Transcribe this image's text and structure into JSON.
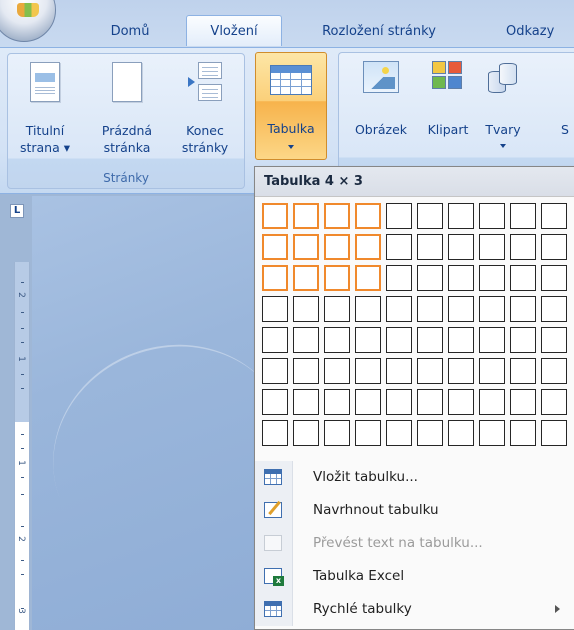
{
  "tabs": [
    {
      "label": "Domů",
      "active": false
    },
    {
      "label": "Vložení",
      "active": true
    },
    {
      "label": "Rozložení stránky",
      "active": false
    },
    {
      "label": "Odkazy",
      "active": false
    }
  ],
  "ribbon": {
    "group_pages": {
      "label": "Stránky",
      "buttons": [
        {
          "line1": "Titulní",
          "line2": "strana ▾",
          "icon": "cover-page-icon"
        },
        {
          "line1": "Prázdná",
          "line2": "stránka",
          "icon": "blank-page-icon"
        },
        {
          "line1": "Konec",
          "line2": "stránky",
          "icon": "page-break-icon"
        }
      ]
    },
    "table_button": {
      "label": "Tabulka",
      "icon": "table-icon"
    },
    "group_illustrations": {
      "buttons": [
        {
          "label": "Obrázek",
          "icon": "picture-icon"
        },
        {
          "label": "Klipart",
          "icon": "clipart-icon"
        },
        {
          "label": "Tvary",
          "icon": "shapes-icon"
        },
        {
          "label": "S",
          "icon": "smartart-icon"
        }
      ]
    }
  },
  "ruler": {
    "corner_label": "L",
    "marks": [
      "2",
      "1",
      "1",
      "2",
      "3"
    ]
  },
  "dropdown": {
    "title": "Tabulka 4 × 3",
    "grid": {
      "columns": 10,
      "rows": 8,
      "selected_columns": 4,
      "selected_rows": 3
    },
    "items": [
      {
        "label": "Vložit tabulku...",
        "icon": "insert-table-icon",
        "disabled": false,
        "submenu": false
      },
      {
        "label": "Navrhnout tabulku",
        "icon": "draw-table-icon",
        "disabled": false,
        "submenu": false
      },
      {
        "label": "Převést text na tabulku...",
        "icon": "convert-text-icon",
        "disabled": true,
        "submenu": false
      },
      {
        "label": "Tabulka Excel",
        "icon": "excel-table-icon",
        "disabled": false,
        "submenu": false
      },
      {
        "label": "Rychlé tabulky",
        "icon": "quick-tables-icon",
        "disabled": false,
        "submenu": true
      }
    ]
  },
  "colors": {
    "accent_highlight": "#f0892c",
    "ribbon_text": "#15428b"
  }
}
